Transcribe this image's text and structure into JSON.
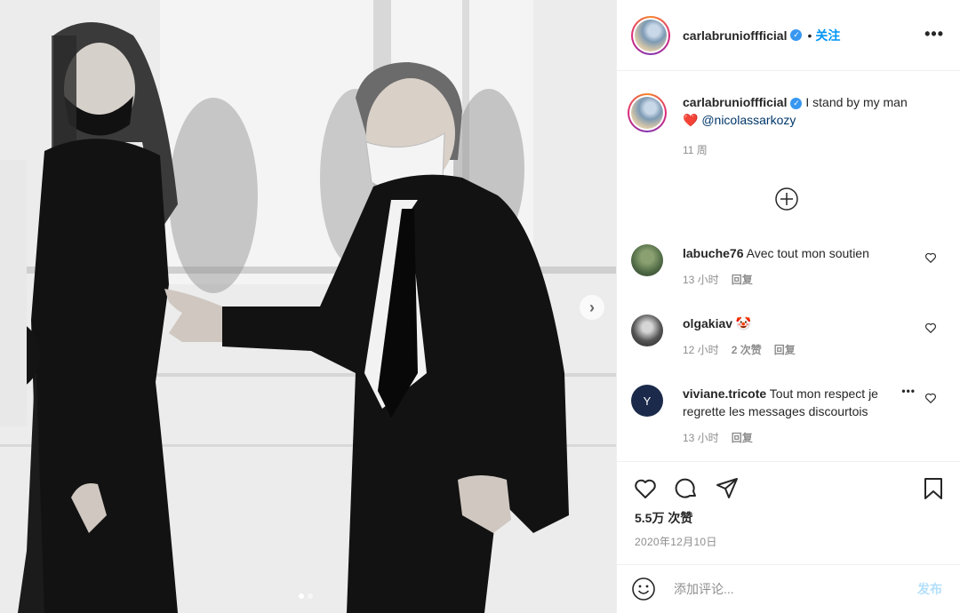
{
  "post": {
    "username": "carlabrunioffficial",
    "separator": "•",
    "follow_label": "关注",
    "more_label": "•••",
    "caption_user": "carlabrunioffficial",
    "caption_text": "I stand by my man",
    "caption_heart": "❤️",
    "caption_mention": "@nicolassarkozy",
    "caption_time": "11 周",
    "likes": "5.5万 次赞",
    "date": "2020年12月10日"
  },
  "comments": [
    {
      "user": "labuche76",
      "text": "Avec tout mon soutien",
      "time": "13 小时",
      "likes": "",
      "reply": "回复"
    },
    {
      "user": "olgakiav",
      "text": "🤡",
      "time": "12 小时",
      "likes": "2 次赞",
      "reply": "回复"
    },
    {
      "user": "viviane.tricote",
      "text": "Tout mon respect je regrette les messages discourtois",
      "time": "13 小时",
      "likes": "",
      "reply": "回复"
    }
  ],
  "composer": {
    "placeholder": "添加评论...",
    "post_label": "发布"
  },
  "carousel": {
    "next_label": "›",
    "index": 1,
    "count": 2
  },
  "colors": {
    "accent": "#0095f6",
    "heart": "#ed4956",
    "muted": "#8e8e8e"
  },
  "icons": [
    "verified-badge-icon",
    "more-options-icon",
    "add-circle-icon",
    "heart-icon",
    "comment-icon",
    "share-icon",
    "bookmark-icon",
    "emoji-icon",
    "chevron-right-icon"
  ]
}
